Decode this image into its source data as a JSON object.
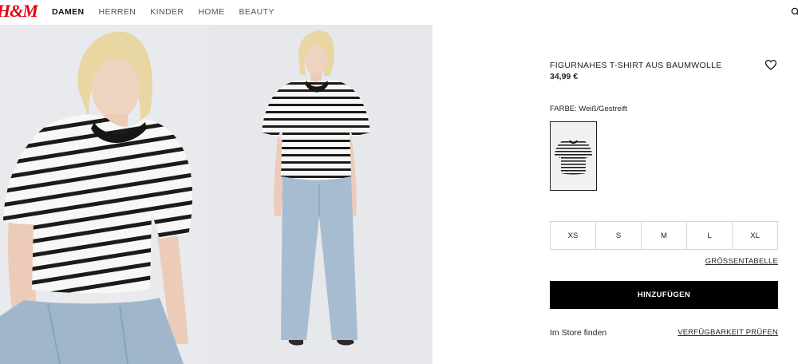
{
  "header": {
    "logo": "H&M",
    "nav": [
      "DAMEN",
      "HERREN",
      "KINDER",
      "HOME",
      "BEAUTY"
    ],
    "active_nav": "DAMEN"
  },
  "product": {
    "title": "FIGURNAHES T-SHIRT AUS BAUMWOLLE",
    "price": "34,99 €",
    "color_label": "FARBE: Weiß/Gestreift",
    "sizes": [
      "XS",
      "S",
      "M",
      "L",
      "XL"
    ],
    "size_guide": "GRÖSSENTABELLE",
    "add_button": "HINZUFÜGEN",
    "store_label": "Im Store finden",
    "availability_link": "VERFÜGBARKEIT PRÜFEN"
  },
  "icons": {
    "search": "search-icon",
    "favorite": "heart-icon"
  },
  "colors": {
    "brand": "#e50010",
    "button": "#000000"
  }
}
